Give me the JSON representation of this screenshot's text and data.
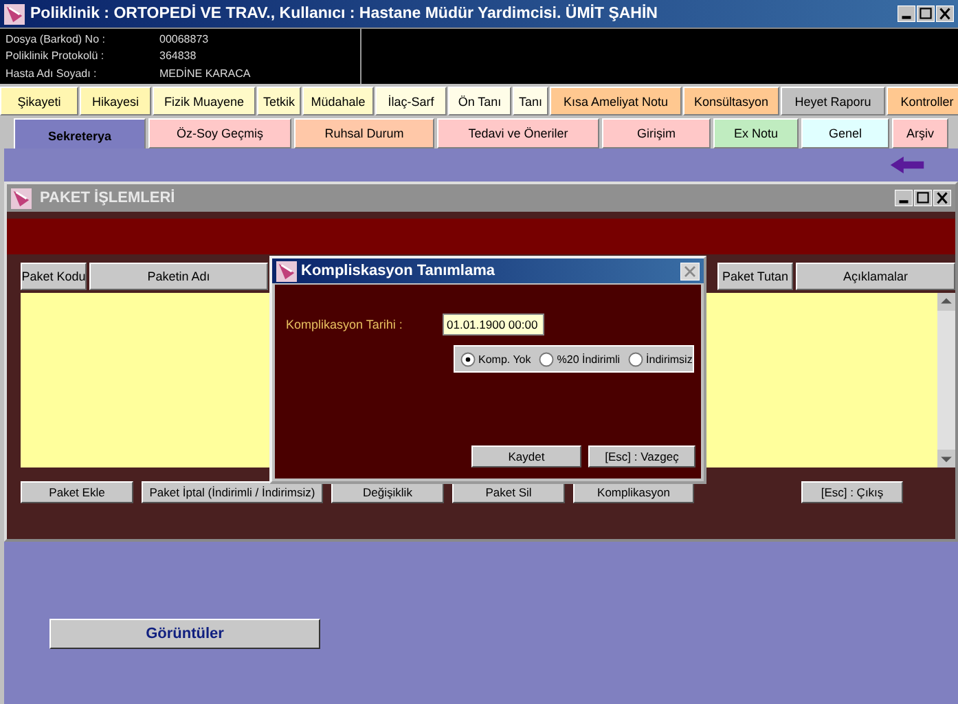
{
  "window": {
    "title": "Poliklinik : ORTOPEDİ VE TRAV., Kullanıcı : Hastane Müdür Yardimcisi. ÜMİT ŞAHİN"
  },
  "patient": [
    {
      "label": "Dosya (Barkod) No :",
      "value": "00068873"
    },
    {
      "label": "Poliklinik Protokolü :",
      "value": "364838"
    },
    {
      "label": "Hasta Adı Soyadı  :",
      "value": "MEDİNE KARACA"
    }
  ],
  "tabs_row_1": [
    {
      "label": "Şikayeti",
      "color": "#fff6b0"
    },
    {
      "label": "Hikayesi",
      "color": "#fff6b0"
    },
    {
      "label": "Fizik Muayene",
      "color": "#fffac8"
    },
    {
      "label": "Tetkik",
      "color": "#fffac8"
    },
    {
      "label": "Müdahale",
      "color": "#fffac8"
    },
    {
      "label": "İlaç-Sarf",
      "color": "#fffde0"
    },
    {
      "label": "Ön Tanı",
      "color": "#fffde8"
    },
    {
      "label": "Tanı",
      "color": "#fffde8"
    },
    {
      "label": "Kısa Ameliyat Notu",
      "color": "#ffc890"
    },
    {
      "label": "Konsültasyon",
      "color": "#ffc890"
    },
    {
      "label": "Heyet Raporu",
      "color": "#c0c0c0"
    },
    {
      "label": "Kontroller",
      "color": "#ffc890"
    }
  ],
  "tabs_row_2": [
    {
      "label": "Sekreterya",
      "color": "#7c7cc0",
      "selected": true
    },
    {
      "label": "Öz-Soy Geçmiş",
      "color": "#ffc8c8",
      "selected": false
    },
    {
      "label": "Ruhsal Durum",
      "color": "#ffc8a8",
      "selected": false
    },
    {
      "label": "Tedavi ve Öneriler",
      "color": "#ffc8c8",
      "selected": false
    },
    {
      "label": "Girişim",
      "color": "#ffc8c8",
      "selected": false
    },
    {
      "label": "Ex Notu",
      "color": "#c0ecc0",
      "selected": false
    },
    {
      "label": "Genel",
      "color": "#e0ffff",
      "selected": false
    },
    {
      "label": "Arşiv",
      "color": "#ffc8c8",
      "selected": false
    }
  ],
  "package_window": {
    "title": "PAKET İŞLEMLERİ",
    "columns": [
      "Paket Kodu",
      "Paketin Adı",
      "Paket Tutan",
      "Açıklamalar"
    ],
    "buttons": [
      "Paket Ekle",
      "Paket İptal (İndirimli / İndirimsiz)",
      "Değişiklik",
      "Paket Sil",
      "Komplikasyon"
    ],
    "exit_button": "[Esc] :  Çıkış"
  },
  "dialog": {
    "title": "Kompliskasyon  Tanımlama",
    "date_label": "Komplikasyon Tarihi :",
    "date_value": "01.01.1900 00:00",
    "options": [
      {
        "label": "Komp. Yok",
        "selected": true
      },
      {
        "label": "%20 İndirimli",
        "selected": false
      },
      {
        "label": "İndirimsiz",
        "selected": false
      }
    ],
    "buttons": [
      "Kaydet",
      "[Esc] :  Vazgeç"
    ]
  },
  "images_button": "Görüntüler"
}
